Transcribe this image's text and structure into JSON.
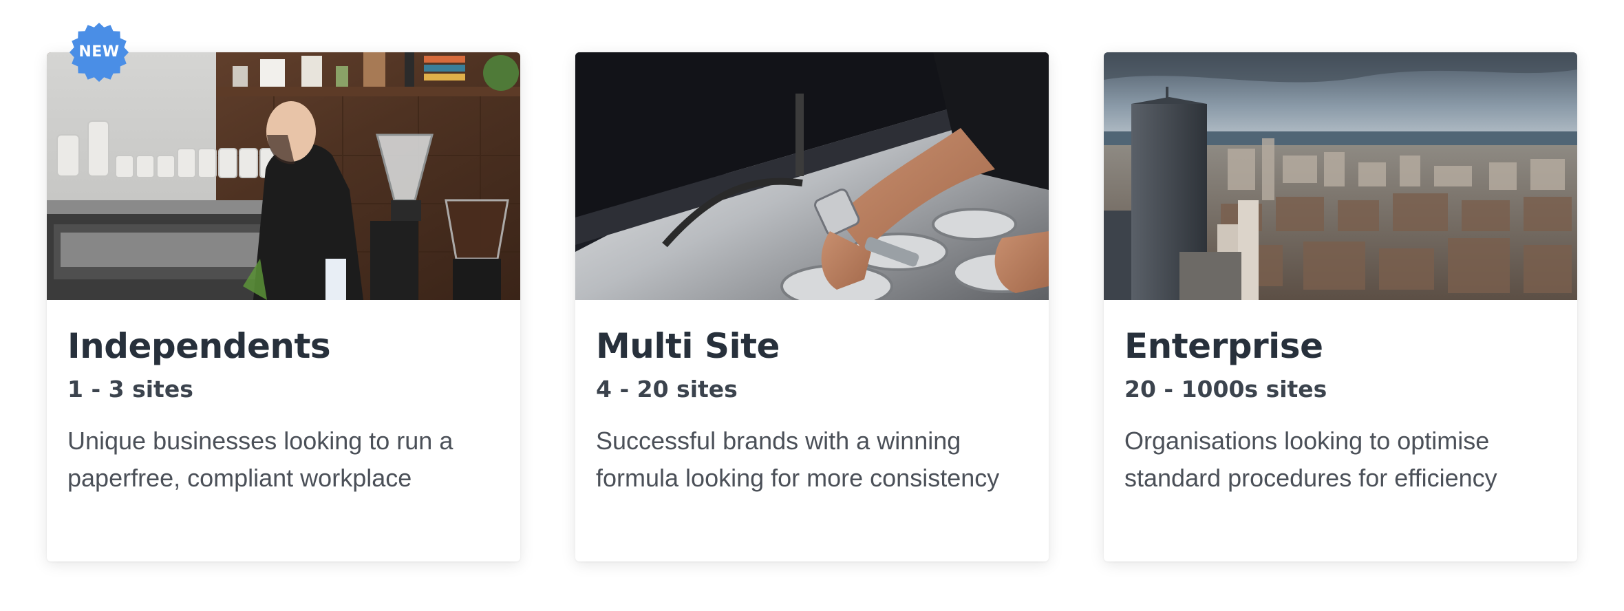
{
  "badge": {
    "label": "NEW",
    "color": "#4a8ee6"
  },
  "cards": [
    {
      "title": "Independents",
      "sites": "1 - 3 sites",
      "description": "Unique businesses looking to run a paperfree, compliant workplace",
      "image": "barista-at-espresso-machine-photo"
    },
    {
      "title": "Multi Site",
      "sites": "4 - 20 sites",
      "description": "Successful brands with a winning formula looking for more consistency",
      "image": "hands-at-coffee-machine-photo"
    },
    {
      "title": "Enterprise",
      "sites": "20 - 1000s sites",
      "description": "Organisations looking to optimise standard procedures for efficiency",
      "image": "city-skyline-aerial-photo"
    }
  ],
  "colors": {
    "title": "#27303b",
    "subtitle": "#3b434d",
    "body": "#4b5058",
    "card_bg": "#ffffff"
  }
}
